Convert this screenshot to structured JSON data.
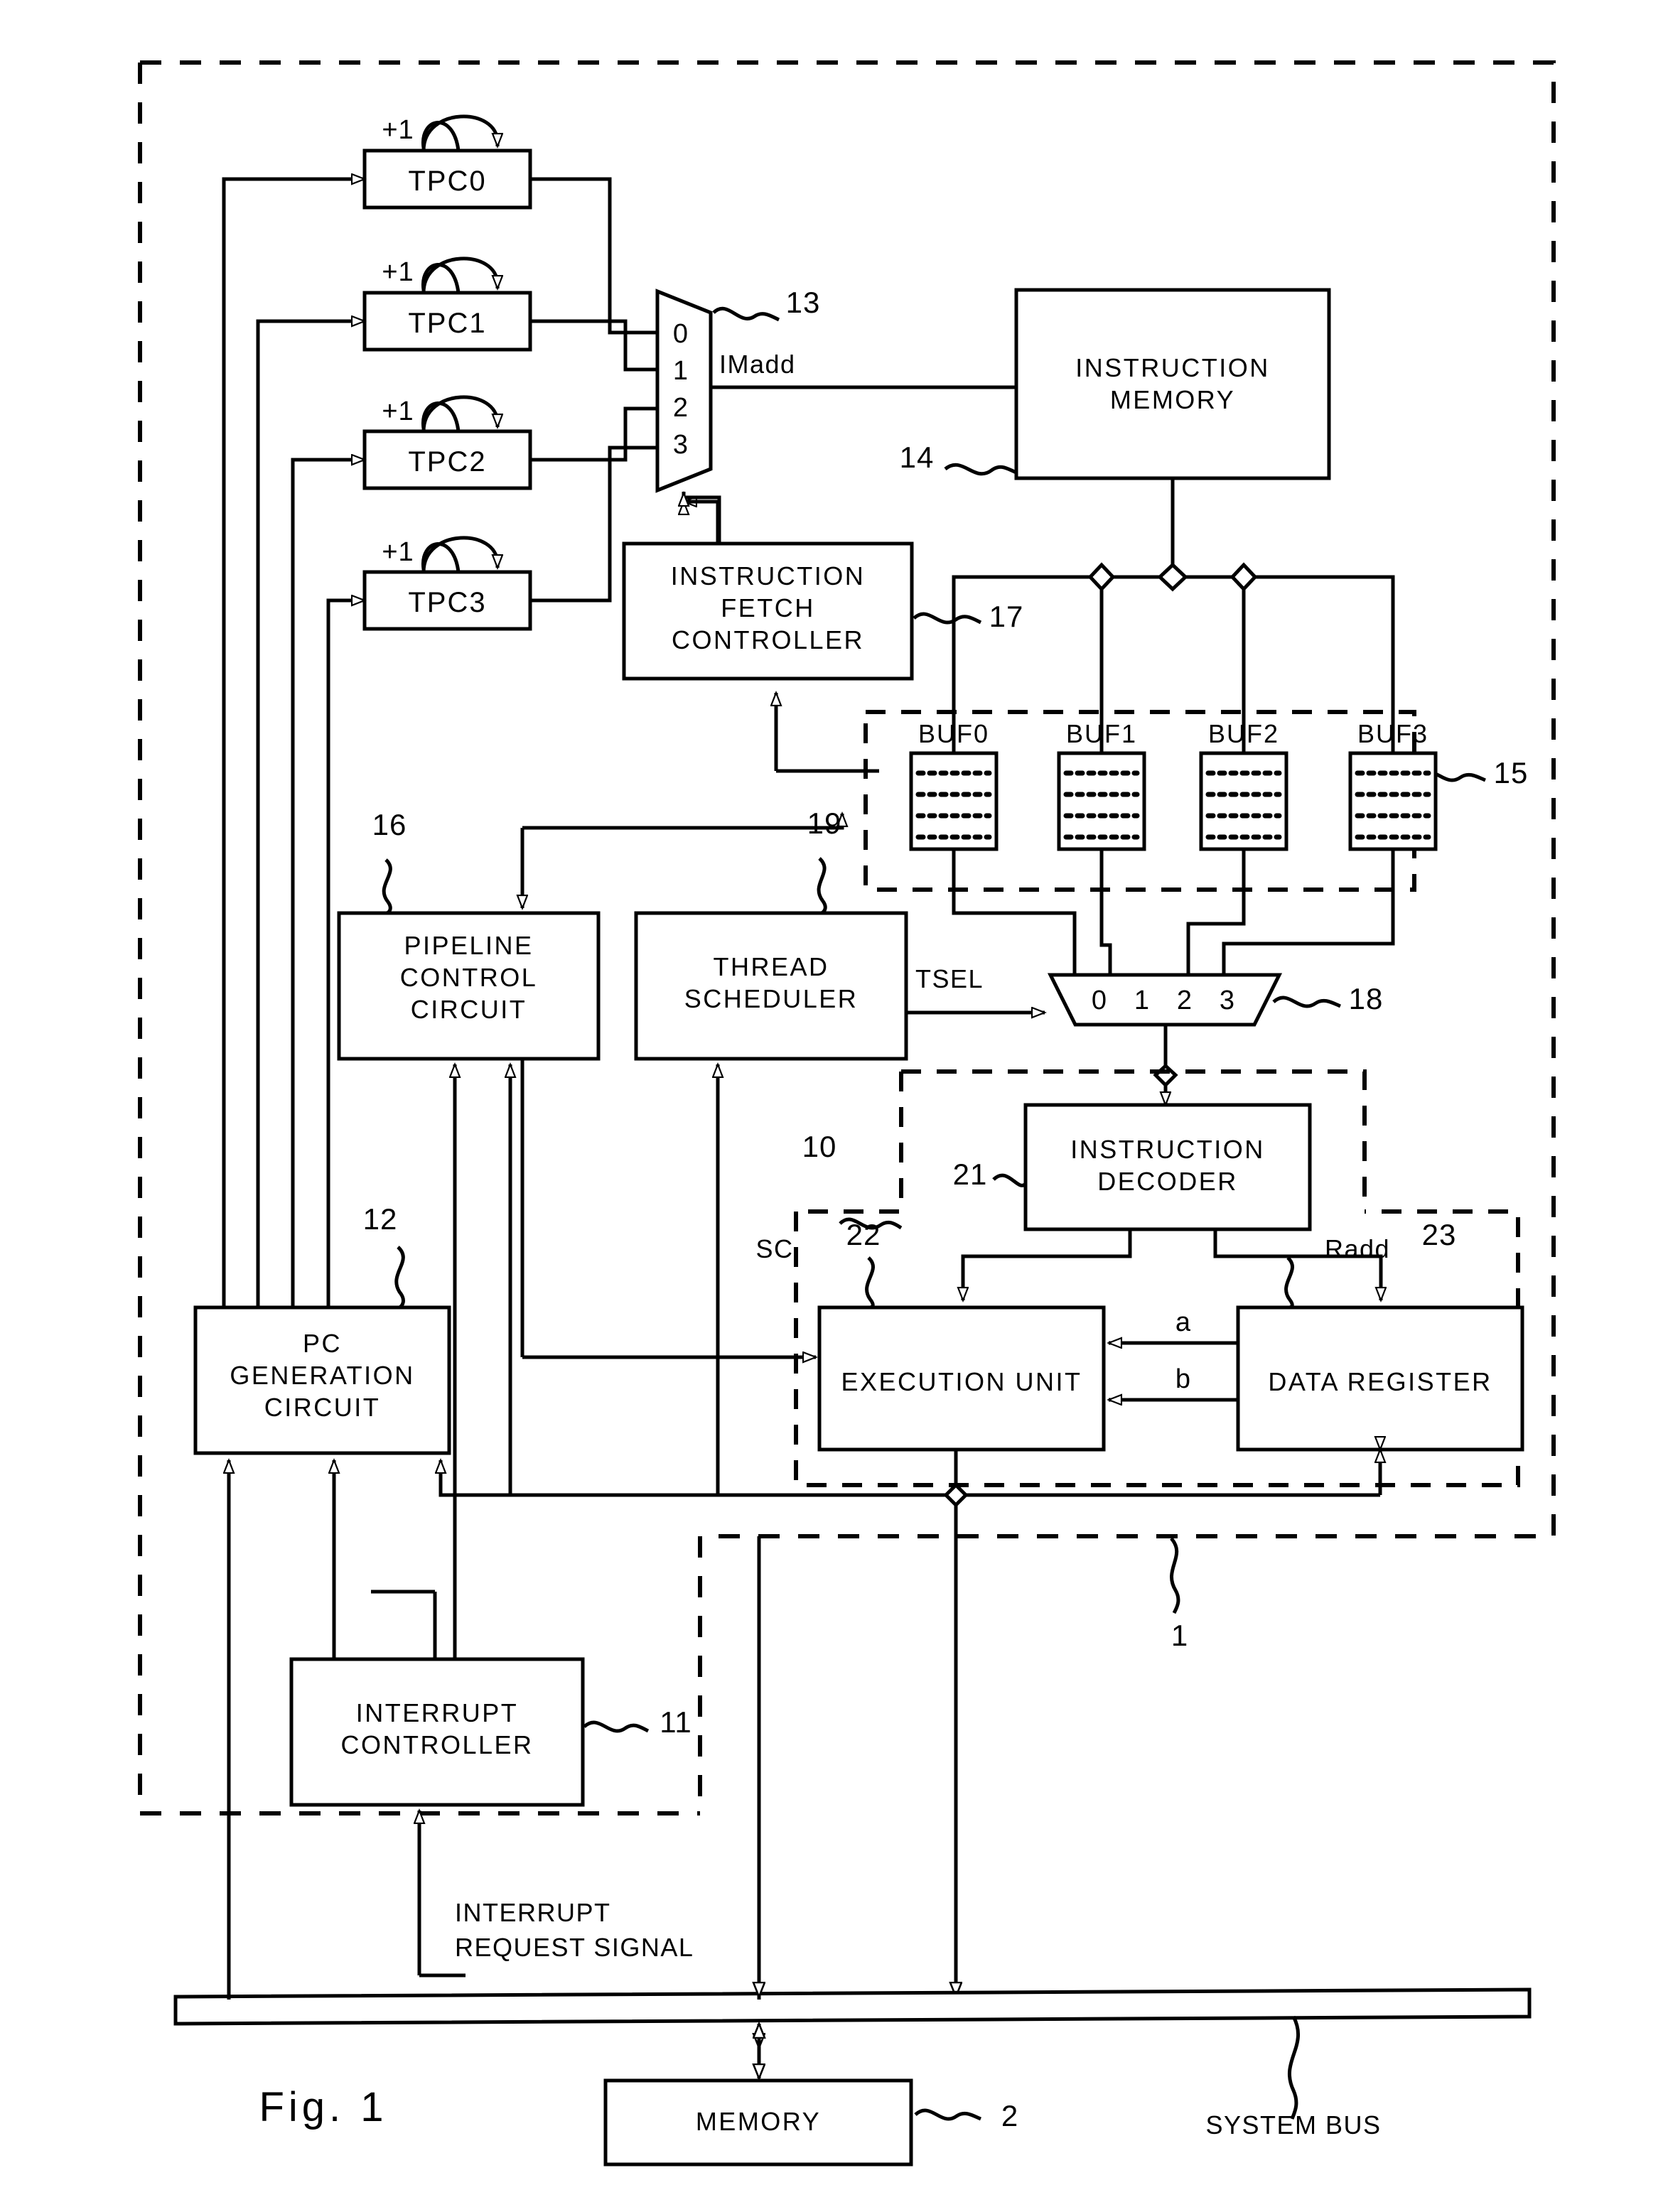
{
  "figure": {
    "caption": "Fig. 1",
    "title": "Multithread processor block diagram"
  },
  "blocks": {
    "tpc0": "TPC0",
    "tpc1": "TPC1",
    "tpc2": "TPC2",
    "tpc3": "TPC3",
    "instruction_memory": "INSTRUCTION\nMEMORY",
    "instruction_fetch_controller": "INSTRUCTION\nFETCH\nCONTROLLER",
    "pipeline_control_circuit": "PIPELINE\nCONTROL\nCIRCUIT",
    "thread_scheduler": "THREAD\nSCHEDULER",
    "instruction_decoder": "INSTRUCTION\nDECODER",
    "execution_unit": "EXECUTION UNIT",
    "data_register": "DATA REGISTER",
    "pc_generation_circuit": "PC\nGENERATION\nCIRCUIT",
    "interrupt_controller": "INTERRUPT\nCONTROLLER",
    "memory": "MEMORY"
  },
  "buffers": {
    "buf0": "BUF0",
    "buf1": "BUF1",
    "buf2": "BUF2",
    "buf3": "BUF3"
  },
  "mux13": {
    "ports": [
      "0",
      "1",
      "2",
      "3"
    ]
  },
  "mux18": {
    "ports": [
      "0",
      "1",
      "2",
      "3"
    ]
  },
  "increments": {
    "tpc0": "+1",
    "tpc1": "+1",
    "tpc2": "+1",
    "tpc3": "+1"
  },
  "signals": {
    "imadd": "IMadd",
    "tsel": "TSEL",
    "sc": "SC",
    "radd": "Radd",
    "bus_a": "a",
    "bus_b": "b",
    "interrupt_request": "INTERRUPT\nREQUEST SIGNAL",
    "system_bus": "SYSTEM BUS"
  },
  "reference_numerals": {
    "n1": "1",
    "n2": "2",
    "n10": "10",
    "n11": "11",
    "n12": "12",
    "n13": "13",
    "n14": "14",
    "n15": "15",
    "n16": "16",
    "n17": "17",
    "n18": "18",
    "n19": "19",
    "n21": "21",
    "n22": "22",
    "n23": "23"
  },
  "colors": {
    "ink": "#000000",
    "paper": "#ffffff"
  }
}
